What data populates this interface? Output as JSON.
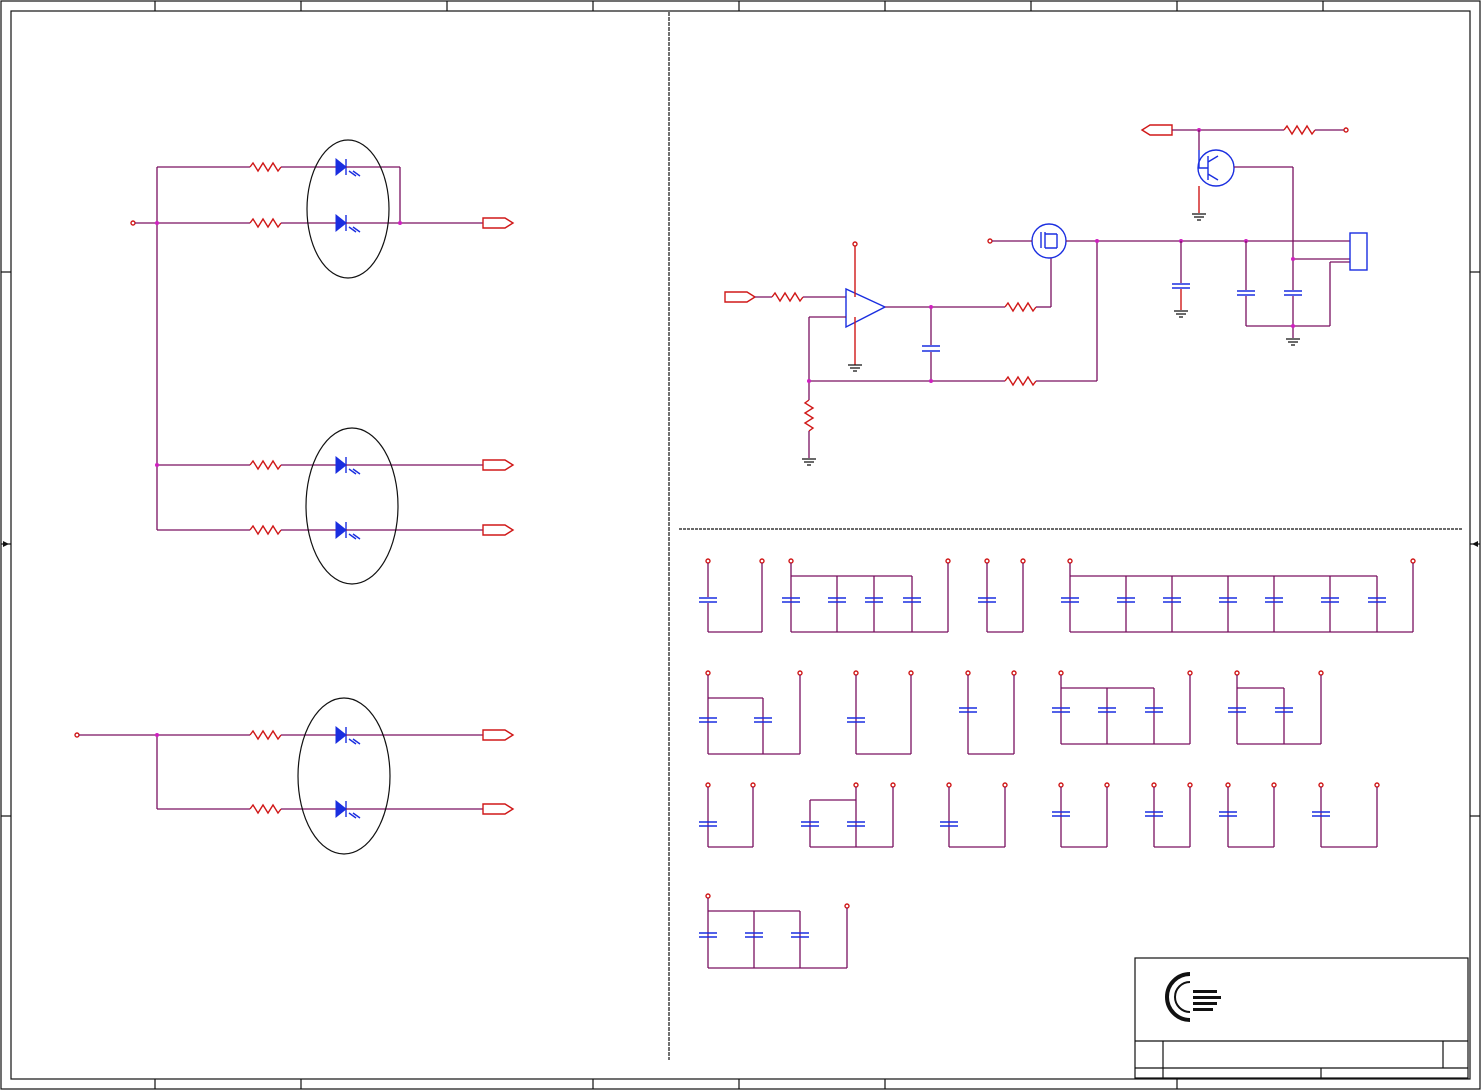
{
  "sheet": {
    "title": "",
    "border_color": "#000000",
    "wire_color": "#7a1060",
    "component_color": "#1a2ee0",
    "pin_color": "#d01818",
    "junction_color": "#d020c0"
  },
  "sections": {
    "led_indicators": {
      "groups": 3,
      "leds_per_group": 2
    },
    "driver_circuit": {
      "parts": [
        "op-amp",
        "mosfet",
        "npn-transistor",
        "connector"
      ]
    },
    "decoupling_capacitors": {
      "rows": 4
    }
  },
  "title_block": {
    "logo": "company-logo-icon",
    "text": ""
  }
}
